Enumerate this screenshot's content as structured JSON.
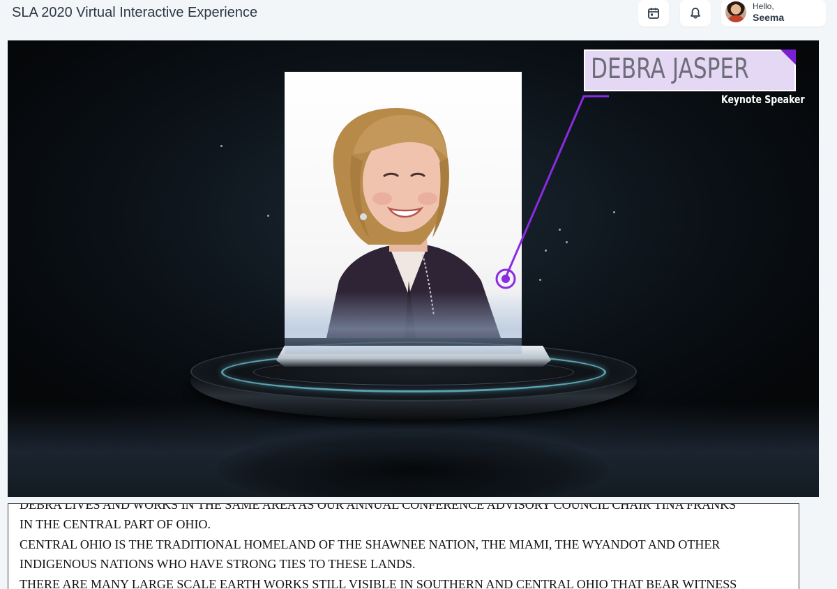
{
  "header": {
    "title": "SLA 2020 Virtual Interactive Experience",
    "calendar_icon": "calendar-icon",
    "notifications_icon": "bell-icon",
    "user": {
      "greeting": "Hello,",
      "name": "Seema"
    }
  },
  "video": {
    "speaker_name": "DEBRA JASPER",
    "speaker_role": "Keynote Speaker",
    "accent_color": "#7a1fd1",
    "ring_color": "#78d2e6"
  },
  "captions": {
    "lines": [
      "DEBRA LIVES AND WORKS IN THE SAME AREA AS OUR ANNUAL CONFERENCE ADVISORY COUNCIL CHAIR TINA FRANKS",
      "IN THE CENTRAL PART OF OHIO.",
      "CENTRAL OHIO IS THE TRADITIONAL HOMELAND OF THE SHAWNEE NATION, THE MIAMI, THE WYANDOT AND OTHER",
      "INDIGENOUS NATIONS WHO HAVE STRONG TIES TO THESE LANDS.",
      "THERE ARE MANY LARGE SCALE EARTH WORKS STILL VISIBLE IN SOUTHERN AND CENTRAL OHIO THAT BEAR WITNESS"
    ]
  }
}
